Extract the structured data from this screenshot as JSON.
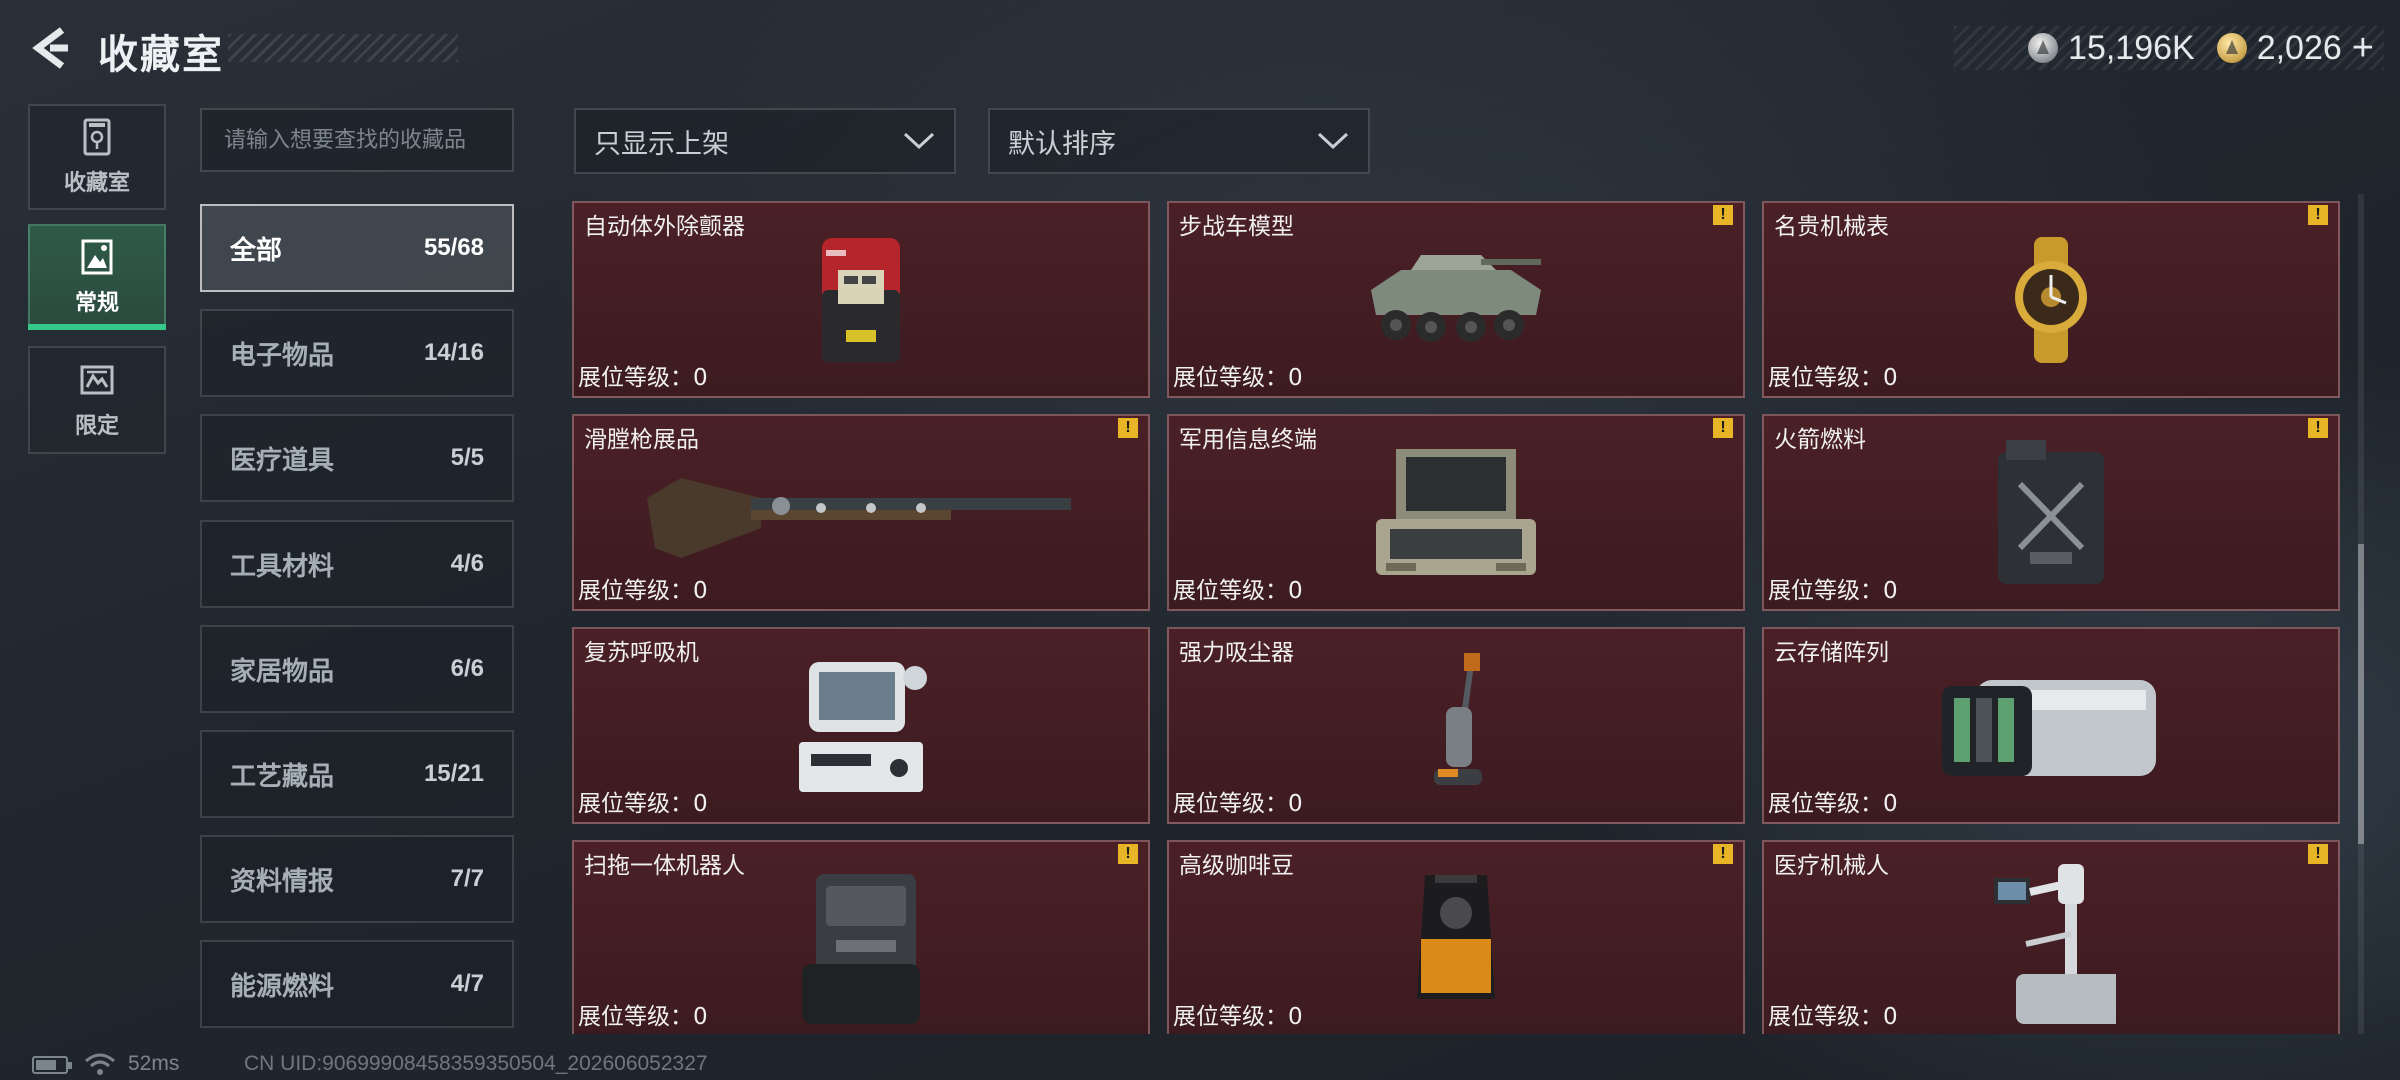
{
  "header": {
    "title": "收藏室",
    "currencies": [
      {
        "icon": "silver-coin-icon",
        "value": "15,196K"
      },
      {
        "icon": "gold-coin-icon",
        "value": "2,026"
      }
    ],
    "add_label": "+"
  },
  "side_tabs": [
    {
      "label": "收藏室",
      "icon": "trophy-cabinet-icon",
      "active": false
    },
    {
      "label": "常规",
      "icon": "image-frame-icon",
      "active": true
    },
    {
      "label": "限定",
      "icon": "limited-badge-icon",
      "active": false
    }
  ],
  "search": {
    "placeholder": "请输入想要查找的收藏品"
  },
  "categories": [
    {
      "label": "全部",
      "count": "55/68",
      "active": true
    },
    {
      "label": "电子物品",
      "count": "14/16"
    },
    {
      "label": "医疗道具",
      "count": "5/5"
    },
    {
      "label": "工具材料",
      "count": "4/6"
    },
    {
      "label": "家居物品",
      "count": "6/6"
    },
    {
      "label": "工艺藏品",
      "count": "15/21"
    },
    {
      "label": "资料情报",
      "count": "7/7"
    },
    {
      "label": "能源燃料",
      "count": "4/7"
    }
  ],
  "filters": {
    "display": "只显示上架",
    "sort": "默认排序"
  },
  "level_label": "展位等级：",
  "items": [
    {
      "name": "",
      "level": "0",
      "warn": false,
      "icon": "item-placeholder"
    },
    {
      "name": "",
      "level": "0",
      "warn": false,
      "icon": "item-placeholder"
    },
    {
      "name": "",
      "level": "0",
      "warn": false,
      "icon": "item-placeholder"
    },
    {
      "name": "自动体外除颤器",
      "level": "0",
      "warn": false,
      "icon": "defibrillator"
    },
    {
      "name": "步战车模型",
      "level": "0",
      "warn": true,
      "icon": "ifv-model"
    },
    {
      "name": "名贵机械表",
      "level": "0",
      "warn": true,
      "icon": "luxury-watch"
    },
    {
      "name": "滑膛枪展品",
      "level": "0",
      "warn": true,
      "icon": "musket"
    },
    {
      "name": "军用信息终端",
      "level": "0",
      "warn": true,
      "icon": "military-terminal"
    },
    {
      "name": "火箭燃料",
      "level": "0",
      "warn": true,
      "icon": "rocket-fuel-can"
    },
    {
      "name": "复苏呼吸机",
      "level": "0",
      "warn": false,
      "icon": "ventilator"
    },
    {
      "name": "强力吸尘器",
      "level": "0",
      "warn": false,
      "icon": "vacuum-cleaner"
    },
    {
      "name": "云存储阵列",
      "level": "0",
      "warn": false,
      "icon": "storage-array"
    },
    {
      "name": "扫拖一体机器人",
      "level": "0",
      "warn": true,
      "icon": "mop-robot"
    },
    {
      "name": "高级咖啡豆",
      "level": "0",
      "warn": true,
      "icon": "coffee-beans"
    },
    {
      "name": "医疗机械人",
      "level": "0",
      "warn": true,
      "icon": "medical-robot"
    }
  ],
  "status": {
    "ping": "52ms",
    "uid": "CN UID:9069990845835935050​4_202606052327"
  }
}
